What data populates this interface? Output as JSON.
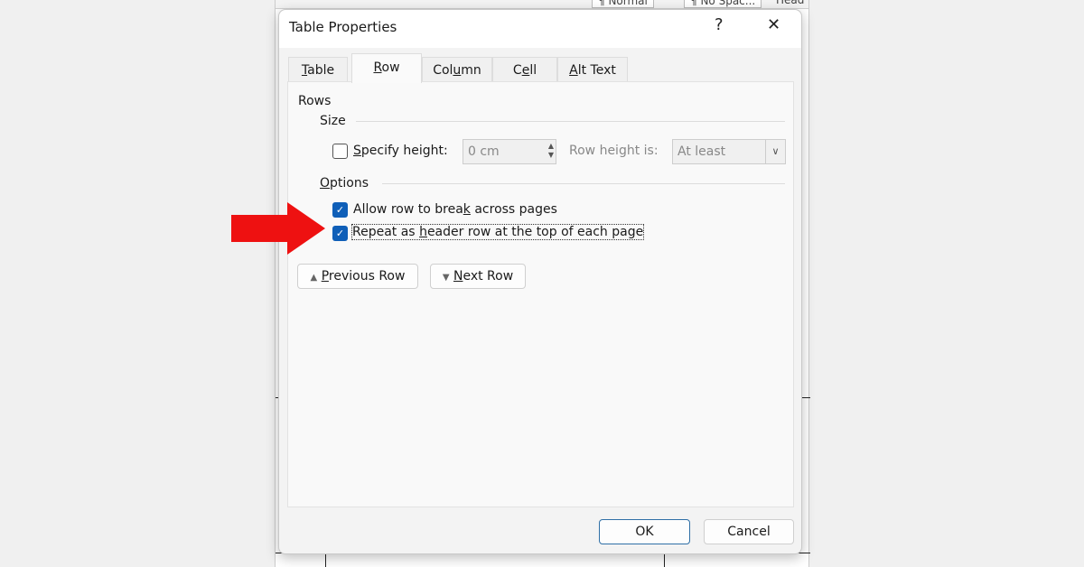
{
  "background": {
    "styles": [
      "¶ Normal",
      "¶ No Spac...",
      "Head"
    ]
  },
  "dialog": {
    "title": "Table Properties",
    "help": "?",
    "close": "✕",
    "tabs": [
      {
        "pre": "",
        "key": "T",
        "post": "able"
      },
      {
        "pre": "",
        "key": "R",
        "post": "ow"
      },
      {
        "pre": "Col",
        "key": "u",
        "post": "mn"
      },
      {
        "pre": "C",
        "key": "e",
        "post": "ll"
      },
      {
        "pre": "",
        "key": "A",
        "post": "lt Text"
      }
    ],
    "selected_tab": "Row",
    "rows_label": "Rows",
    "size_label": "Size",
    "specify_height": {
      "pre": "",
      "key": "S",
      "post": "pecify height:",
      "checked": false
    },
    "height_value": "0 cm",
    "row_height_is": "Row height is:",
    "row_height_mode": "At least",
    "options_label": {
      "pre": "",
      "key": "O",
      "post": "ptions"
    },
    "allow_break": {
      "pre": "Allow row to brea",
      "key": "k",
      "post": " across pages",
      "checked": true
    },
    "repeat_header": {
      "pre": "Repeat as ",
      "key": "h",
      "post": "eader row at the top of each page",
      "checked": true
    },
    "prev_row": {
      "pre": "",
      "key": "P",
      "post": "revious Row"
    },
    "next_row": {
      "pre": "",
      "key": "N",
      "post": "ext Row"
    },
    "ok": "OK",
    "cancel": "Cancel"
  },
  "colors": {
    "arrow": "#ee1111",
    "checkbox": "#0f5fb8",
    "ok_border": "#2f6fa6"
  }
}
